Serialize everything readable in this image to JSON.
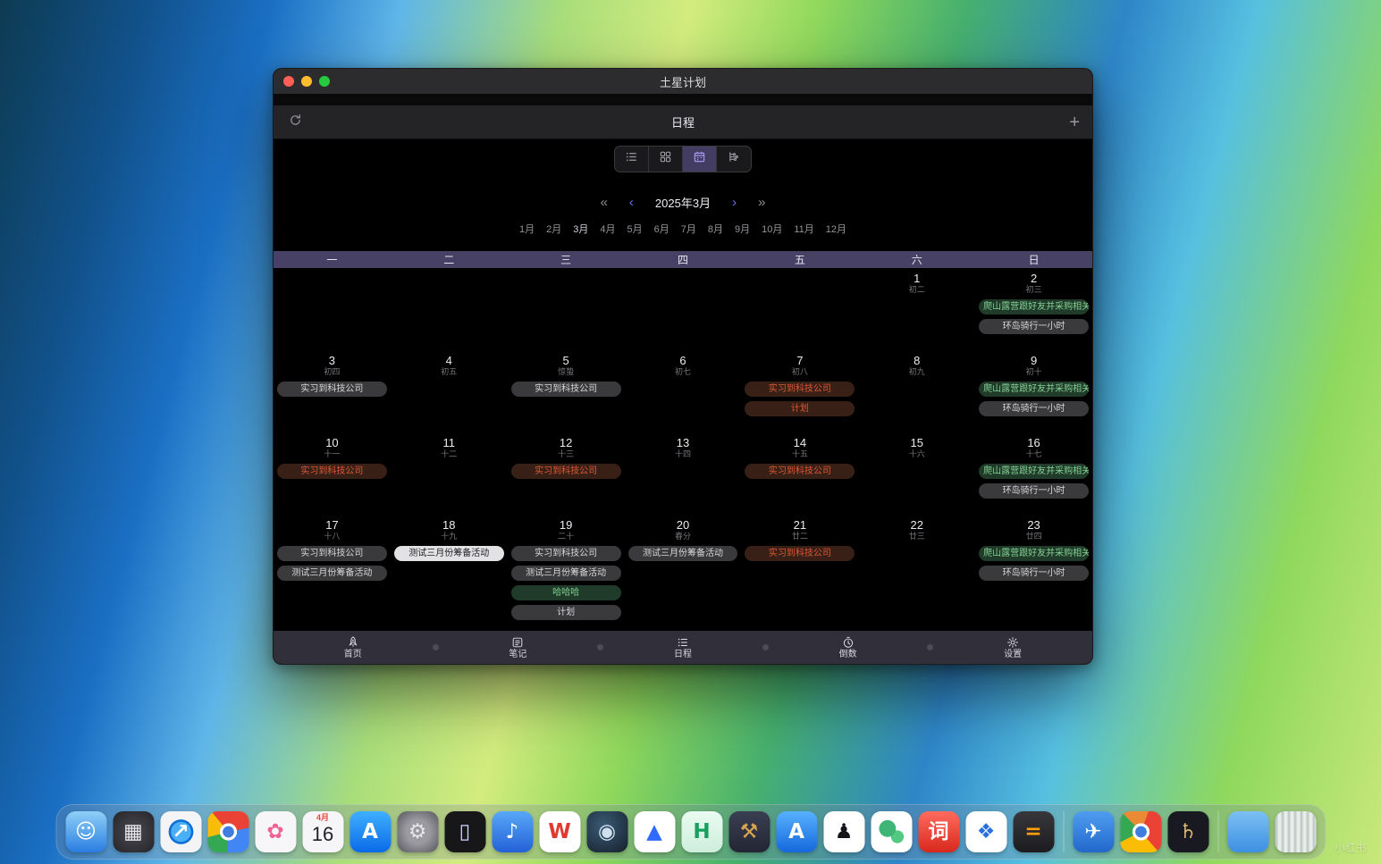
{
  "window": {
    "title": "土星计划",
    "toolbar": {
      "title": "日程",
      "add_icon": "+"
    }
  },
  "view_switcher": {
    "options": [
      "list",
      "kanban",
      "calendar",
      "timeline"
    ],
    "selected": "calendar"
  },
  "month_nav": {
    "prev_year_icon": "«",
    "prev_month_icon": "‹",
    "label": "2025年3月",
    "next_month_icon": "›",
    "next_year_icon": "»",
    "months": [
      "1月",
      "2月",
      "3月",
      "4月",
      "5月",
      "6月",
      "7月",
      "8月",
      "9月",
      "10月",
      "11月",
      "12月"
    ],
    "selected_month": "3月"
  },
  "calendar": {
    "weekdays": [
      "一",
      "二",
      "三",
      "四",
      "五",
      "六",
      "日"
    ],
    "event_colors": {
      "green": "#82cf93",
      "gray": "#d8d8da",
      "orange": "#de5733",
      "selected": "#1d1d20"
    },
    "weeks": [
      [
        {},
        {},
        {},
        {},
        {},
        {
          "date": "1",
          "lunar": "初二",
          "events": []
        },
        {
          "date": "2",
          "lunar": "初三",
          "events": [
            {
              "text": "爬山露营跟好友并采购相关物品",
              "color": "green"
            },
            {
              "text": "环岛骑行一小时",
              "color": "gray"
            }
          ]
        }
      ],
      [
        {
          "date": "3",
          "lunar": "初四",
          "events": [
            {
              "text": "实习到科技公司",
              "color": "gray"
            }
          ]
        },
        {
          "date": "4",
          "lunar": "初五",
          "events": []
        },
        {
          "date": "5",
          "lunar": "惊蛰",
          "events": [
            {
              "text": "实习到科技公司",
              "color": "gray"
            }
          ]
        },
        {
          "date": "6",
          "lunar": "初七",
          "events": []
        },
        {
          "date": "7",
          "lunar": "初八",
          "events": [
            {
              "text": "实习到科技公司",
              "color": "orange"
            },
            {
              "text": "计划",
              "color": "orange"
            }
          ]
        },
        {
          "date": "8",
          "lunar": "初九",
          "events": []
        },
        {
          "date": "9",
          "lunar": "初十",
          "events": [
            {
              "text": "爬山露营跟好友并采购相关物品",
              "color": "green"
            },
            {
              "text": "环岛骑行一小时",
              "color": "gray"
            }
          ]
        }
      ],
      [
        {
          "date": "10",
          "lunar": "十一",
          "events": [
            {
              "text": "实习到科技公司",
              "color": "orange"
            }
          ]
        },
        {
          "date": "11",
          "lunar": "十二",
          "events": []
        },
        {
          "date": "12",
          "lunar": "十三",
          "events": [
            {
              "text": "实习到科技公司",
              "color": "orange"
            }
          ]
        },
        {
          "date": "13",
          "lunar": "十四",
          "events": []
        },
        {
          "date": "14",
          "lunar": "十五",
          "events": [
            {
              "text": "实习到科技公司",
              "color": "orange"
            }
          ]
        },
        {
          "date": "15",
          "lunar": "十六",
          "events": []
        },
        {
          "date": "16",
          "lunar": "十七",
          "events": [
            {
              "text": "爬山露营跟好友并采购相关物品",
              "color": "green"
            },
            {
              "text": "环岛骑行一小时",
              "color": "gray"
            }
          ]
        }
      ],
      [
        {
          "date": "17",
          "lunar": "十八",
          "events": [
            {
              "text": "实习到科技公司",
              "color": "gray"
            },
            {
              "text": "测试三月份筹备活动",
              "color": "gray"
            }
          ]
        },
        {
          "date": "18",
          "lunar": "十九",
          "events": [
            {
              "text": "测试三月份筹备活动",
              "color": "selected"
            }
          ]
        },
        {
          "date": "19",
          "lunar": "二十",
          "events": [
            {
              "text": "实习到科技公司",
              "color": "gray"
            },
            {
              "text": "测试三月份筹备活动",
              "color": "gray"
            },
            {
              "text": "哈哈哈",
              "color": "green"
            },
            {
              "text": "计划",
              "color": "gray"
            }
          ]
        },
        {
          "date": "20",
          "lunar": "春分",
          "events": [
            {
              "text": "测试三月份筹备活动",
              "color": "gray"
            }
          ]
        },
        {
          "date": "21",
          "lunar": "廿二",
          "events": [
            {
              "text": "实习到科技公司",
              "color": "orange"
            }
          ]
        },
        {
          "date": "22",
          "lunar": "廿三",
          "events": []
        },
        {
          "date": "23",
          "lunar": "廿四",
          "events": [
            {
              "text": "爬山露营跟好友并采购相关物品",
              "color": "green"
            },
            {
              "text": "环岛骑行一小时",
              "color": "gray"
            }
          ]
        }
      ]
    ]
  },
  "bottom_nav": {
    "items": [
      {
        "label": "首页",
        "icon": "home"
      },
      {
        "label": "笔记",
        "icon": "notes"
      },
      {
        "label": "日程",
        "icon": "schedule"
      },
      {
        "label": "倒数",
        "icon": "countdown"
      },
      {
        "label": "设置",
        "icon": "settings"
      }
    ],
    "active": "日程"
  },
  "dock": {
    "items": [
      {
        "name": "finder",
        "bg": "linear-gradient(180deg,#8ed0f8,#2a7de1)",
        "glyph": "☺",
        "fg": "#ffffff"
      },
      {
        "name": "launchpad",
        "bg": "radial-gradient(circle,#4a4a52,#242428)",
        "glyph": "▦",
        "fg": "#e8e8ec"
      },
      {
        "name": "safari",
        "bg": "radial-gradient(circle at 50% 50%, #4ab0f5 0 34%, #0f6fd6 35% 42%, #f4f4f6 43%)",
        "glyph": "↗",
        "fg": "#ffffff"
      },
      {
        "name": "chrome",
        "bg": "radial-gradient(circle at 50% 50%, #3f7de0 0 19%, #ffffff 20% 29%, rgba(0,0,0,0) 30%), conic-gradient(from -40deg, #ea4335 0 33%, #4285f4 33% 62%, #34a853 62% 82%, #fbbc05 82% 100%)",
        "glyph": "",
        "fg": ""
      },
      {
        "name": "photos",
        "bg": "#f6f6f8",
        "glyph": "✿",
        "fg": "#f06292"
      },
      {
        "name": "calendar",
        "type": "calendar",
        "top": "4月",
        "day": "16"
      },
      {
        "name": "app-store",
        "bg": "linear-gradient(180deg,#3fb0ff,#0a6ae8)",
        "glyph": "A",
        "fg": "#ffffff"
      },
      {
        "name": "system-settings",
        "bg": "radial-gradient(circle,#9a9aa0 0 40%,#55555c)",
        "glyph": "⚙",
        "fg": "#e6e6ea"
      },
      {
        "name": "iphone-mirroring",
        "bg": "#17171a",
        "glyph": "▯",
        "fg": "#cfd4ff"
      },
      {
        "name": "music-app",
        "bg": "linear-gradient(180deg,#59a7f7,#2361d8)",
        "glyph": "♪",
        "fg": "#ffffff"
      },
      {
        "name": "wps-office",
        "bg": "#ffffff",
        "glyph": "W",
        "fg": "#e0392e"
      },
      {
        "name": "steam",
        "bg": "radial-gradient(circle at 40% 35%, #3a5a74, #16202c)",
        "glyph": "◉",
        "fg": "#cfe0ee"
      },
      {
        "name": "drive-app",
        "bg": "#ffffff",
        "glyph": "▲",
        "fg": "#2f6bff"
      },
      {
        "name": "h-app",
        "bg": "linear-gradient(180deg,#eafbf2,#cdeeda)",
        "glyph": "H",
        "fg": "#18a05e"
      },
      {
        "name": "hammer-app",
        "bg": "linear-gradient(180deg,#3a3f52,#232633)",
        "glyph": "⚒",
        "fg": "#d8a44c"
      },
      {
        "name": "app-a-blue",
        "bg": "linear-gradient(180deg,#57b1ff,#1668dc)",
        "glyph": "A",
        "fg": "#ffffff"
      },
      {
        "name": "qq",
        "bg": "#ffffff",
        "glyph": "♟",
        "fg": "#14141a"
      },
      {
        "name": "wechat",
        "bg": "radial-gradient(circle at 40% 42%, #3eb575 0 24%, rgba(0,0,0,0) 25%), radial-gradient(circle at 64% 62%, #54c983 0 17%, rgba(0,0,0,0) 18%), #ffffff",
        "glyph": "",
        "fg": ""
      },
      {
        "name": "dictionary",
        "bg": "linear-gradient(180deg,#ff6b5e,#d8281c)",
        "glyph": "词",
        "fg": "#ffffff"
      },
      {
        "name": "windows-app",
        "bg": "#ffffff",
        "glyph": "❖",
        "fg": "#2a6fe0"
      },
      {
        "name": "calculator",
        "bg": "linear-gradient(180deg,#38383c,#1c1c1f)",
        "glyph": "=",
        "fg": "#ff9f0a"
      },
      {
        "type": "separator"
      },
      {
        "name": "plane-app",
        "bg": "linear-gradient(180deg,#4f9df0,#2268cc)",
        "glyph": "✈",
        "fg": "#ffffff"
      },
      {
        "name": "browser",
        "bg": "radial-gradient(circle at 50% 50%, #3f7de0 0 19%, #ffffff 20% 29%, rgba(0,0,0,0) 30%), conic-gradient(from 20deg, #ea4335 0 33%, #fbbc05 33% 62%, #34a853 62% 82%, #ea8a35 82% 100%)",
        "glyph": "",
        "fg": ""
      },
      {
        "name": "saturn-plan",
        "bg": "#191922",
        "glyph": "♄",
        "fg": "#d8b56a"
      },
      {
        "type": "separator"
      },
      {
        "name": "downloads-folder",
        "bg": "linear-gradient(180deg,#7cc0f4,#3d8fe2)",
        "glyph": "",
        "fg": ""
      },
      {
        "name": "trash",
        "bg": "repeating-linear-gradient(90deg, rgba(200,205,215,0.85) 0 3px, rgba(240,242,246,0.9) 3px 7px)",
        "glyph": "",
        "fg": ""
      }
    ]
  },
  "watermark": "小红书"
}
